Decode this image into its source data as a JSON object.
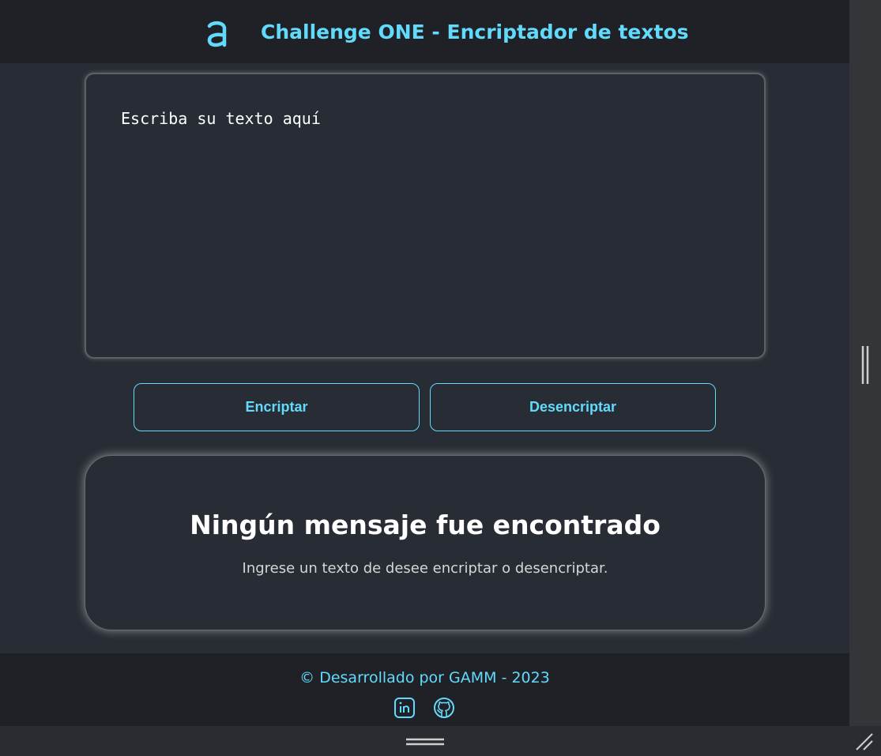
{
  "header": {
    "logo_icon": "alura-logo-icon",
    "title": "Challenge ONE - Encriptador de textos"
  },
  "input": {
    "placeholder": "Escriba su texto aquí",
    "value": ""
  },
  "buttons": {
    "encrypt_label": "Encriptar",
    "decrypt_label": "Desencriptar"
  },
  "output": {
    "title": "Ningún mensaje fue encontrado",
    "subtitle": "Ingrese un texto de desee encriptar o desencriptar."
  },
  "footer": {
    "copyright": "© Desarrollado por GAMM - 2023",
    "social": [
      "linkedin-icon",
      "github-icon"
    ]
  },
  "colors": {
    "accent": "#61dafb",
    "background": "#282c34",
    "header_bg": "#1f2126",
    "text": "#ffffff"
  }
}
